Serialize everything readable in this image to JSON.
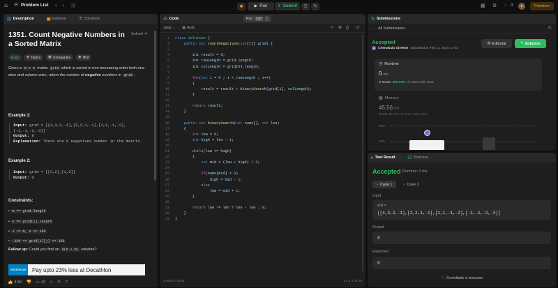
{
  "topbar": {
    "problem_list": "Problem List",
    "run": "Run",
    "submit": "Submit",
    "notifications": "0",
    "premium": "Premium"
  },
  "description_panel": {
    "tabs": [
      "Description",
      "Editorial",
      "Solutions"
    ],
    "title": "1351. Count Negative Numbers in a Sorted Matrix",
    "solved": "Solved",
    "tags": [
      "Easy",
      "Topics",
      "Companies",
      "Hint"
    ],
    "statement": {
      "p1": "Given a",
      "code1": "m x n",
      "p2": "matrix",
      "code2": "grid",
      "p3": "which is sorted in non-increasing order both row-wise and column-wise, return",
      "p4": "the number of",
      "p5": "negative",
      "p6": "numbers in",
      "code3": "grid",
      "p7": "."
    },
    "example1": {
      "heading": "Example 1:",
      "input_label": "Input:",
      "input_value": "grid = [[4,3,2,-1],[3,2,1,-1],[1,1,-1,-2],[-1,-1,-2,-3]]",
      "output_label": "Output:",
      "output_value": "8",
      "explanation_label": "Explanation:",
      "explanation_value": "There are 8 negatives number in the matrix."
    },
    "example2": {
      "heading": "Example 2:",
      "input_label": "Input:",
      "input_value": "grid = [[3,2],[1,0]]",
      "output_label": "Output:",
      "output_value": "0"
    },
    "constraints": {
      "heading": "Constraints:",
      "items": [
        "m == grid.length",
        "n == grid[i].length",
        "1 <= m, n <= 100",
        "-100 <= grid[i][j] <= 100"
      ]
    },
    "follow_up": {
      "label": "Follow up:",
      "text1": "Could you find an",
      "code": "O(n + m)",
      "text2": "solution?"
    },
    "ad": {
      "brand": "DECATHLON",
      "text": "Pay upto 23% less at Decathlon"
    },
    "footer": {
      "likes": "4.5K",
      "comments": "42"
    }
  },
  "code_panel": {
    "title": "Code",
    "run_hint": "Run",
    "run_shortcut": "Ctrl",
    "run_key": "'",
    "language": "Java",
    "auto": "Auto",
    "status": "Saved to local",
    "cursor": "Ln 8, Col 45",
    "lines": [
      [
        [
          "kw",
          "class "
        ],
        [
          "ty",
          "Solution"
        ],
        [
          "pu",
          " {"
        ]
      ],
      [
        [
          "pu",
          "    "
        ],
        [
          "kw",
          "public int "
        ],
        [
          "fn",
          "countNegatives"
        ],
        [
          "pu",
          "("
        ],
        [
          "kw",
          "int"
        ],
        [
          "pu",
          "[][] "
        ],
        [
          "vr",
          "grid"
        ],
        [
          "pu",
          ") {"
        ]
      ],
      [
        [
          "pu",
          ""
        ]
      ],
      [
        [
          "pu",
          "        "
        ],
        [
          "vr",
          "int "
        ],
        [
          "vr",
          "result"
        ],
        [
          "pu",
          " = "
        ],
        [
          "nm",
          "0"
        ],
        [
          "pu",
          ";"
        ]
      ],
      [
        [
          "pu",
          "        "
        ],
        [
          "vr",
          "int "
        ],
        [
          "vr",
          "rowLength"
        ],
        [
          "pu",
          " = "
        ],
        [
          "vr",
          "grid"
        ],
        [
          "pu",
          "."
        ],
        [
          "vr",
          "length"
        ],
        [
          "pu",
          ";"
        ]
      ],
      [
        [
          "pu",
          "        "
        ],
        [
          "vr",
          "int "
        ],
        [
          "vr",
          "colLength"
        ],
        [
          "pu",
          " = "
        ],
        [
          "vr",
          "grid"
        ],
        [
          "pu",
          "["
        ],
        [
          "nm",
          "0"
        ],
        [
          "pu",
          "]."
        ],
        [
          "vr",
          "length"
        ],
        [
          "pu",
          ";"
        ]
      ],
      [
        [
          "pu",
          ""
        ]
      ],
      [
        [
          "pu",
          "        "
        ],
        [
          "ct",
          "for"
        ],
        [
          "pu",
          "("
        ],
        [
          "kw",
          "int "
        ],
        [
          "vr",
          "i"
        ],
        [
          "pu",
          " = "
        ],
        [
          "nm",
          "0"
        ],
        [
          "pu",
          " ; "
        ],
        [
          "vr",
          "i"
        ],
        [
          "pu",
          " < "
        ],
        [
          "vr",
          "rowLength"
        ],
        [
          "pu",
          " ; "
        ],
        [
          "vr",
          "i"
        ],
        [
          "pu",
          "++)"
        ]
      ],
      [
        [
          "pu",
          "        {"
        ]
      ],
      [
        [
          "pu",
          "            "
        ],
        [
          "vr",
          "result"
        ],
        [
          "pu",
          " = "
        ],
        [
          "vr",
          "result"
        ],
        [
          "pu",
          " + "
        ],
        [
          "fn",
          "binarySearch"
        ],
        [
          "pu",
          "("
        ],
        [
          "vr",
          "grid"
        ],
        [
          "pu",
          "["
        ],
        [
          "vr",
          "i"
        ],
        [
          "pu",
          "], "
        ],
        [
          "vr",
          "colLength"
        ],
        [
          "pu",
          ");"
        ]
      ],
      [
        [
          "pu",
          "        }"
        ]
      ],
      [
        [
          "pu",
          ""
        ]
      ],
      [
        [
          "pu",
          "        "
        ],
        [
          "ct",
          "return "
        ],
        [
          "vr",
          "result"
        ],
        [
          "pu",
          ";"
        ]
      ],
      [
        [
          "pu",
          "    }"
        ]
      ],
      [
        [
          "pu",
          ""
        ]
      ],
      [
        [
          "pu",
          "    "
        ],
        [
          "kw",
          "public int "
        ],
        [
          "fn",
          "binarySearch"
        ],
        [
          "pu",
          "("
        ],
        [
          "kw",
          "int "
        ],
        [
          "vr",
          "nums"
        ],
        [
          "pu",
          "[], "
        ],
        [
          "kw",
          "int "
        ],
        [
          "vr",
          "len"
        ],
        [
          "pu",
          ")"
        ]
      ],
      [
        [
          "pu",
          "    {"
        ]
      ],
      [
        [
          "pu",
          "        "
        ],
        [
          "kw",
          "int "
        ],
        [
          "vr",
          "low"
        ],
        [
          "pu",
          " = "
        ],
        [
          "nm",
          "0"
        ],
        [
          "pu",
          ";"
        ]
      ],
      [
        [
          "pu",
          "        "
        ],
        [
          "kw",
          "int "
        ],
        [
          "vr",
          "high"
        ],
        [
          "pu",
          " = "
        ],
        [
          "vr",
          "len"
        ],
        [
          "pu",
          " - "
        ],
        [
          "nm",
          "1"
        ],
        [
          "pu",
          ";"
        ]
      ],
      [
        [
          "pu",
          ""
        ]
      ],
      [
        [
          "pu",
          "        "
        ],
        [
          "ct",
          "while"
        ],
        [
          "pu",
          "("
        ],
        [
          "vr",
          "low"
        ],
        [
          "pu",
          " <= "
        ],
        [
          "vr",
          "high"
        ],
        [
          "pu",
          ")"
        ]
      ],
      [
        [
          "pu",
          "        {"
        ]
      ],
      [
        [
          "pu",
          "            "
        ],
        [
          "kw",
          "int "
        ],
        [
          "vr",
          "mid"
        ],
        [
          "pu",
          " = ("
        ],
        [
          "vr",
          "low"
        ],
        [
          "pu",
          " + "
        ],
        [
          "vr",
          "high"
        ],
        [
          "pu",
          ") / "
        ],
        [
          "nm",
          "2"
        ],
        [
          "pu",
          ";"
        ]
      ],
      [
        [
          "pu",
          ""
        ]
      ],
      [
        [
          "pu",
          "            "
        ],
        [
          "ct",
          "if"
        ],
        [
          "pu",
          "("
        ],
        [
          "vr",
          "nums"
        ],
        [
          "pu",
          "["
        ],
        [
          "vr",
          "mid"
        ],
        [
          "pu",
          "] < "
        ],
        [
          "nm",
          "0"
        ],
        [
          "pu",
          ")"
        ]
      ],
      [
        [
          "pu",
          "                "
        ],
        [
          "vr",
          "high"
        ],
        [
          "pu",
          " = "
        ],
        [
          "vr",
          "mid"
        ],
        [
          "pu",
          " - "
        ],
        [
          "nm",
          "1"
        ],
        [
          "pu",
          ";"
        ]
      ],
      [
        [
          "pu",
          "            "
        ],
        [
          "ct",
          "else"
        ]
      ],
      [
        [
          "pu",
          "                "
        ],
        [
          "vr",
          "low"
        ],
        [
          "pu",
          " = "
        ],
        [
          "vr",
          "mid"
        ],
        [
          "pu",
          " + "
        ],
        [
          "nm",
          "1"
        ],
        [
          "pu",
          ";"
        ]
      ],
      [
        [
          "pu",
          "        }"
        ]
      ],
      [
        [
          "pu",
          ""
        ]
      ],
      [
        [
          "pu",
          "        "
        ],
        [
          "ct",
          "return "
        ],
        [
          "vr",
          "low"
        ],
        [
          "pu",
          " != "
        ],
        [
          "vr",
          "len"
        ],
        [
          "pu",
          " ? "
        ],
        [
          "vr",
          "len"
        ],
        [
          "pu",
          " - "
        ],
        [
          "vr",
          "low"
        ],
        [
          "pu",
          " : "
        ],
        [
          "nm",
          "0"
        ],
        [
          "pu",
          ";"
        ]
      ],
      [
        [
          "pu",
          "    }"
        ]
      ],
      [
        [
          "pu",
          "}"
        ]
      ]
    ]
  },
  "submissions_panel": {
    "title": "Submissions",
    "back": "All Submissions",
    "status": "Accepted",
    "user": "Chenakala Gireesh",
    "submitted": "submitted at Feb 11, 2024 17:03",
    "editorial": "Editorial",
    "solution": "Solution",
    "runtime_label": "Runtime",
    "runtime_value": "0",
    "runtime_unit": "ms",
    "runtime_beats": "Beats",
    "runtime_pct": "100.00%",
    "runtime_suffix": "of users with Java",
    "memory_label": "Memory",
    "memory_value": "45.56",
    "memory_unit": "MB",
    "memory_beats": "Beats 36.16% of users with Java",
    "chart_y1": "60%",
    "chart_y2": "40%"
  },
  "test_panel": {
    "tabs": [
      "Test Result",
      "Testcase"
    ],
    "status": "Accepted",
    "runtime": "Runtime: 0 ms",
    "cases": [
      "Case 1",
      "Case 2"
    ],
    "input_label": "Input",
    "input_var": "grid =",
    "input_value": "[[4,3,2,-1],[3,2,1,-1],[1,1,-1,-2],[-1,-1,-2,-3]]",
    "output_label": "Output",
    "output_value": "8",
    "expected_label": "Expected",
    "expected_value": "8",
    "contribute": "Contribute a testcase"
  },
  "colors": {
    "accent_orange": "#ffa116",
    "accent_green": "#2cbb5d",
    "panel_bg": "#1e1e1e",
    "header_bg": "#282828"
  }
}
